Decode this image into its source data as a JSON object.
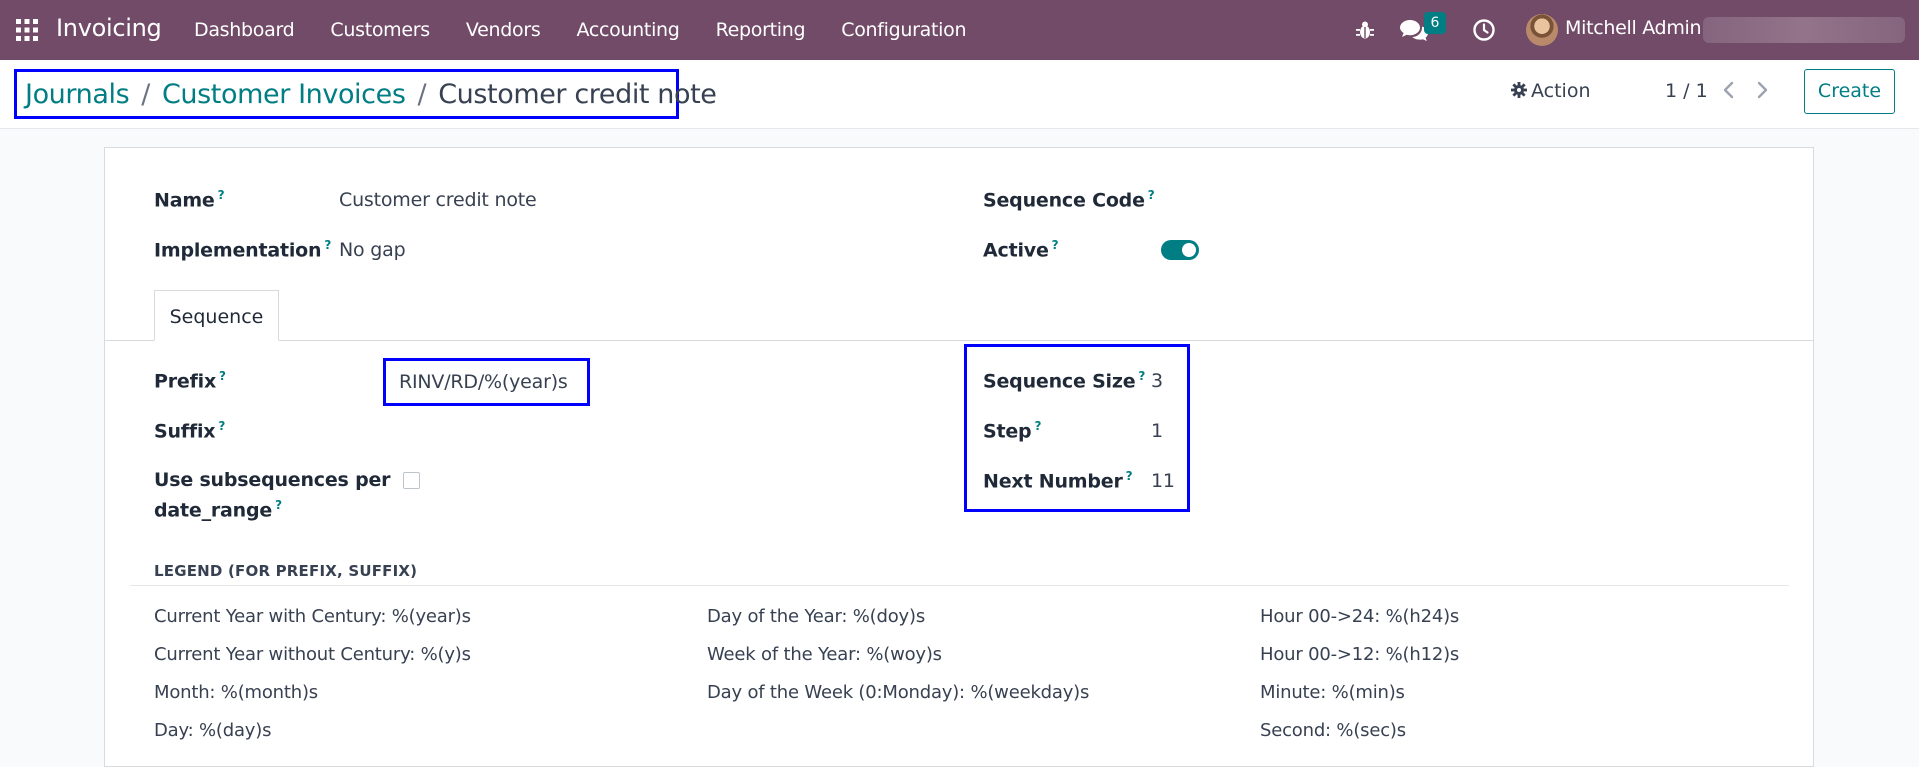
{
  "navbar": {
    "app_name": "Invoicing",
    "menu": [
      "Dashboard",
      "Customers",
      "Vendors",
      "Accounting",
      "Reporting",
      "Configuration"
    ],
    "chat_badge": "6",
    "user_name": "Mitchell Admin",
    "bg_color": "#714b67"
  },
  "breadcrumb": {
    "items": [
      "Journals",
      "Customer Invoices"
    ],
    "current": "Customer credit note",
    "separator": "/"
  },
  "control": {
    "action_label": "Action",
    "pager": "1 / 1",
    "create_label": "Create"
  },
  "form": {
    "name_label": "Name",
    "name_value": "Customer credit note",
    "implementation_label": "Implementation",
    "implementation_value": "No gap",
    "sequence_code_label": "Sequence Code",
    "sequence_code_value": "",
    "active_label": "Active",
    "active": true,
    "help_mark": "?"
  },
  "tabs": [
    "Sequence"
  ],
  "sequence": {
    "prefix_label": "Prefix",
    "prefix_value": "RINV/RD/%(year)s",
    "suffix_label": "Suffix",
    "subseq_label_1": "Use subsequences per",
    "subseq_label_2": "date_range",
    "subseq_checked": false,
    "size_label": "Sequence Size",
    "size_value": "3",
    "step_label": "Step",
    "step_value": "1",
    "next_label": "Next Number",
    "next_value": "11"
  },
  "legend": {
    "title": "LEGEND (FOR PREFIX, SUFFIX)",
    "col1": [
      "Current Year with Century: %(year)s",
      "Current Year without Century: %(y)s",
      "Month: %(month)s",
      "Day: %(day)s"
    ],
    "col2": [
      "Day of the Year: %(doy)s",
      "Week of the Year: %(woy)s",
      "Day of the Week (0:Monday): %(weekday)s"
    ],
    "col3": [
      "Hour 00->24: %(h24)s",
      "Hour 00->12: %(h12)s",
      "Minute: %(min)s",
      "Second: %(sec)s"
    ]
  },
  "colors": {
    "accent": "#017e84",
    "highlight": "#0000ff"
  }
}
